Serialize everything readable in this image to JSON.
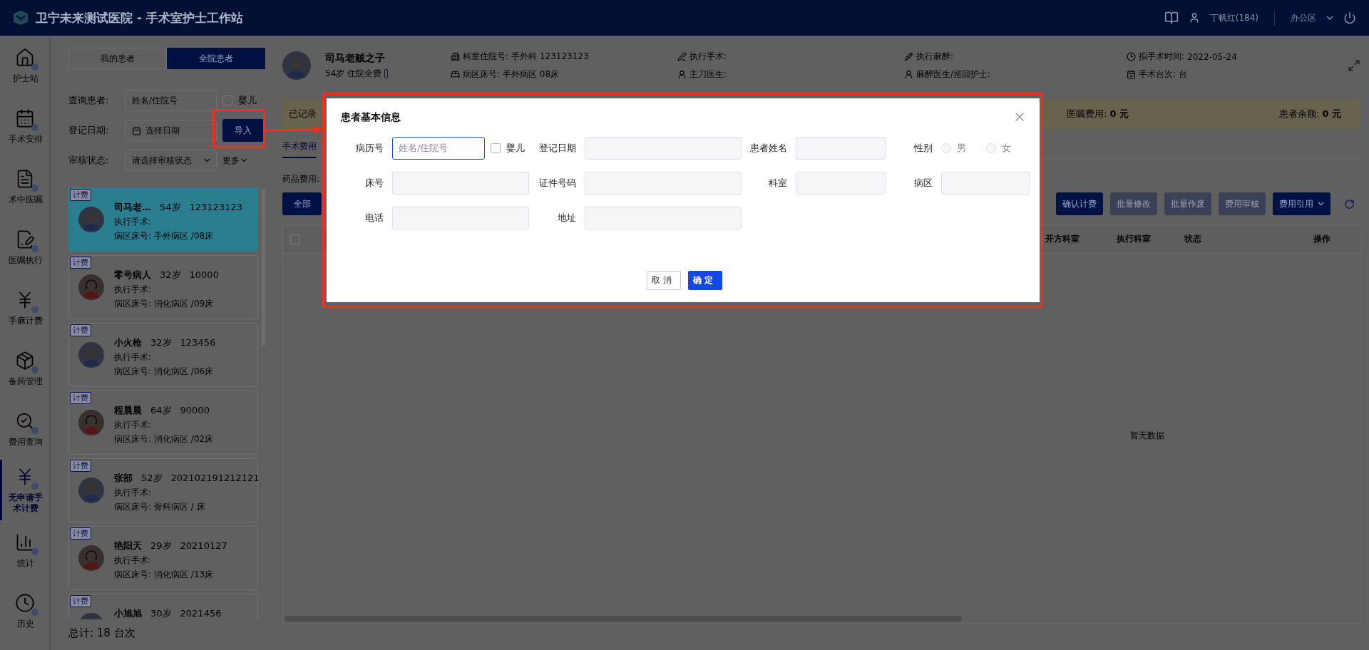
{
  "header": {
    "title": "卫宁未来测试医院 - 手术室护士工作站",
    "user": "丁帆红(184)",
    "location": "办公区"
  },
  "nav": [
    {
      "label": "护士站",
      "kind": "station",
      "selected": false
    },
    {
      "label": "手术安排",
      "kind": "schedule",
      "selected": false
    },
    {
      "label": "术中医嘱",
      "kind": "orders",
      "selected": false
    },
    {
      "label": "医嘱执行",
      "kind": "execute",
      "selected": false
    },
    {
      "label": "手麻计费",
      "kind": "billing",
      "selected": false
    },
    {
      "label": "备药管理",
      "kind": "stock",
      "selected": false
    },
    {
      "label": "费用查询",
      "kind": "query",
      "selected": false
    },
    {
      "label": "无申请手术计费",
      "kind": "billing",
      "selected": true
    },
    {
      "label": "统计",
      "kind": "stats",
      "selected": false
    },
    {
      "label": "历史",
      "kind": "history",
      "selected": false
    }
  ],
  "patient_tabs": [
    {
      "label": "我的患者",
      "selected": false
    },
    {
      "label": "全院患者",
      "selected": true
    }
  ],
  "filters": {
    "patient_label": "查询患者:",
    "patient_placeholder": "姓名/住院号",
    "baby_label": "婴儿",
    "baby_checked": false,
    "date_label": "登记日期:",
    "date_placeholder": "选择日期",
    "import_button": "导入",
    "status_label": "审核状态:",
    "status_placeholder": "请选择审核状态",
    "more": "更多"
  },
  "patients": [
    {
      "tag": "计费",
      "name": "司马老…",
      "age": "54岁",
      "number": "123123123",
      "surgery_label": "执行手术:",
      "ward_label": "病区床号:",
      "ward": "手外病区 /08床",
      "kind": "male",
      "selected": true
    },
    {
      "tag": "计费",
      "name": "零号病人",
      "age": "32岁",
      "number": "10000",
      "surgery_label": "执行手术:",
      "ward_label": "病区床号:",
      "ward": "消化病区 /09床",
      "kind": "female",
      "selected": false
    },
    {
      "tag": "计费",
      "name": "小火枪",
      "age": "32岁",
      "number": "123456",
      "surgery_label": "执行手术:",
      "ward_label": "病区床号:",
      "ward": "消化病区 /06床",
      "kind": "male",
      "selected": false
    },
    {
      "tag": "计费",
      "name": "程晨晨",
      "age": "64岁",
      "number": "90000",
      "surgery_label": "执行手术:",
      "ward_label": "病区床号:",
      "ward": "消化病区 /02床",
      "kind": "female",
      "selected": false
    },
    {
      "tag": "计费",
      "name": "张部",
      "age": "52岁",
      "number": "202102191212121",
      "surgery_label": "执行手术:",
      "ward_label": "病区床号:",
      "ward": "骨科病区 / 床",
      "kind": "male",
      "selected": false
    },
    {
      "tag": "计费",
      "name": "艳阳天",
      "age": "29岁",
      "number": "20210127",
      "surgery_label": "执行手术:",
      "ward_label": "病区床号:",
      "ward": "消化病区 /13床",
      "kind": "female",
      "selected": false
    },
    {
      "tag": "计费",
      "name": "小旭旭",
      "age": "30岁",
      "number": "2021456",
      "kind": "male",
      "selected": false
    }
  ],
  "total": "总计:  18 台次",
  "patient_header": {
    "name": "司马老贼之子",
    "age": "54岁",
    "payment": "住院全费",
    "info": [
      {
        "kind": "dept",
        "label": "科室住院号:",
        "value": "手外科 123123123"
      },
      {
        "kind": "surgery",
        "label": "执行手术:"
      },
      {
        "kind": "anesthesia",
        "label": "执行麻醉:"
      },
      {
        "kind": "time",
        "label": "拟手术时间:",
        "value": "2022-05-24"
      },
      {
        "kind": "bed",
        "label": "病区床号:",
        "value": "手外病区 08床"
      },
      {
        "kind": "surgeon",
        "label": "主刀医生:"
      },
      {
        "kind": "nurse",
        "label": "麻醉医生/巡回护士:"
      },
      {
        "kind": "sequence",
        "label": "手术台次:",
        "value": "台"
      }
    ]
  },
  "summary": {
    "recorded": "已记录",
    "order_fee": "医嘱费用: **0 元**",
    "balance": "患者余额: **0 元**"
  },
  "content_tabs": [
    {
      "label": "手术费用",
      "selected": true
    }
  ],
  "drug_fee": "药品费用:",
  "filter_button": "全部",
  "actions": [
    {
      "label": "确认计费",
      "kind": "plain",
      "disabled": false
    },
    {
      "label": "批量修改",
      "kind": "plain",
      "disabled": true
    },
    {
      "label": "批量作废",
      "kind": "plain",
      "disabled": true
    },
    {
      "label": "费用审核",
      "kind": "plain",
      "disabled": true
    },
    {
      "label": "费用引用",
      "kind": "dropdown",
      "disabled": false
    }
  ],
  "table": {
    "select_all_checked": false,
    "columns": [
      "开方科室",
      "执行科室",
      "状态",
      "操作"
    ],
    "empty": "暂无数据"
  },
  "dialog": {
    "title": "患者基本信息",
    "fields": [
      {
        "kind": "text",
        "label": "病历号",
        "placeholder": "姓名/住院号",
        "focused": true,
        "checkbox": {
          "label": "婴儿",
          "checked": false
        }
      },
      {
        "kind": "text",
        "label": "登记日期",
        "focused": false
      },
      {
        "kind": "text",
        "label": "患者姓名",
        "focused": false
      },
      {
        "kind": "radio",
        "label": "性别",
        "options": [
          {
            "label": "男",
            "selected": false
          },
          {
            "label": "女",
            "selected": false
          }
        ]
      },
      {
        "kind": "text",
        "label": "床号",
        "focused": false
      },
      {
        "kind": "text",
        "label": "证件号码",
        "focused": false
      },
      {
        "kind": "text",
        "label": "科室",
        "focused": false
      },
      {
        "kind": "text",
        "label": "病区",
        "focused": false
      },
      {
        "kind": "text",
        "label": "电话",
        "focused": false
      },
      {
        "kind": "text",
        "label": "地址",
        "focused": false
      }
    ],
    "cancel": "取消",
    "confirm": "确定"
  }
}
